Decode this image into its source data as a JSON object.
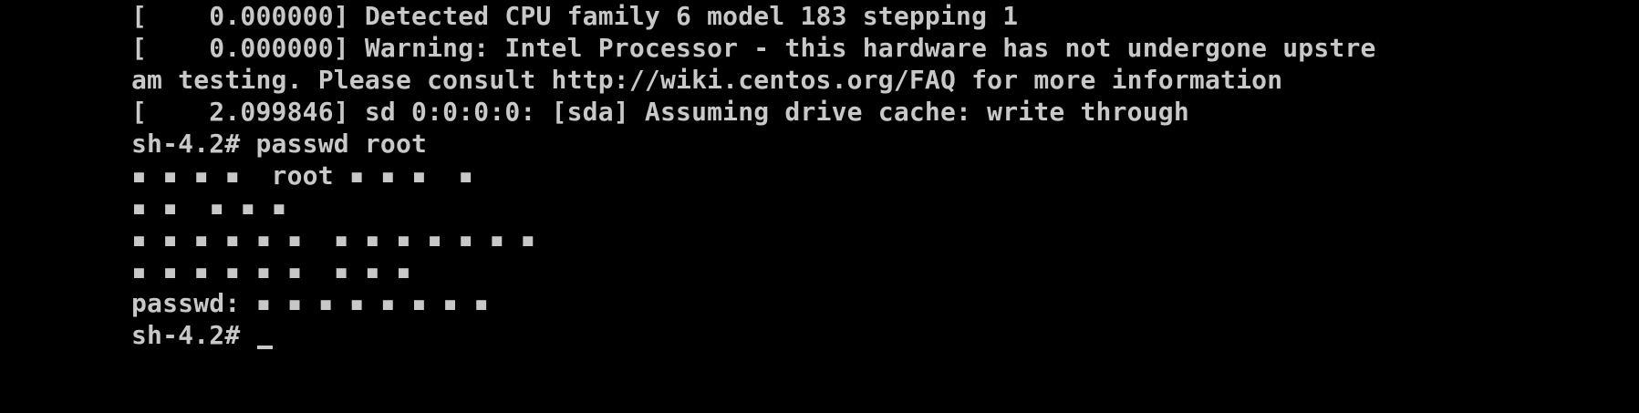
{
  "console": {
    "lines": [
      "[    0.000000] Detected CPU family 6 model 183 stepping 1",
      "[    0.000000] Warning: Intel Processor - this hardware has not undergone upstre",
      "am testing. Please consult http://wiki.centos.org/FAQ for more information",
      "[    2.099846] sd 0:0:0:0: [sda] Assuming drive cache: write through",
      "sh-4.2# passwd root",
      "▪ ▪ ▪ ▪  root ▪ ▪ ▪  ▪",
      "▪ ▪  ▪ ▪ ▪",
      "▪ ▪ ▪ ▪ ▪ ▪  ▪ ▪ ▪ ▪ ▪ ▪ ▪",
      "▪ ▪ ▪ ▪ ▪ ▪  ▪ ▪ ▪",
      "passwd: ▪ ▪ ▪ ▪ ▪ ▪ ▪ ▪",
      "sh-4.2# "
    ],
    "text_color": "#c8c8c8",
    "background_color": "#000000"
  }
}
